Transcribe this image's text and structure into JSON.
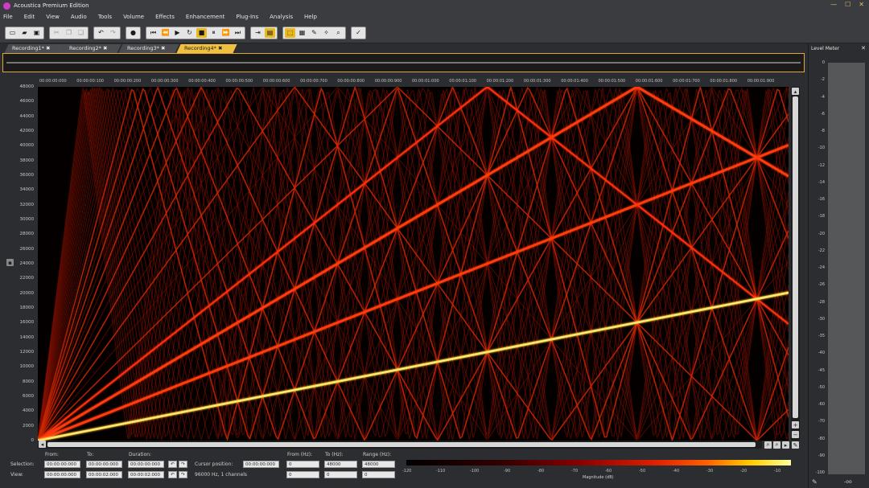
{
  "window": {
    "title": "Acoustica Premium Edition"
  },
  "menu": [
    "File",
    "Edit",
    "View",
    "Audio",
    "Tools",
    "Volume",
    "Effects",
    "Enhancement",
    "Plug-Ins",
    "Analysis",
    "Help"
  ],
  "tabs": [
    {
      "label": "Recording1*",
      "active": false
    },
    {
      "label": "Recording2*",
      "active": false
    },
    {
      "label": "Recording3*",
      "active": false
    },
    {
      "label": "Recording4*",
      "active": true
    }
  ],
  "frequency_axis": [
    "48000",
    "46000",
    "44000",
    "42000",
    "40000",
    "38000",
    "36000",
    "34000",
    "32000",
    "30000",
    "28000",
    "26000",
    "24000",
    "22000",
    "20000",
    "18000",
    "16000",
    "14000",
    "12000",
    "10000",
    "8000",
    "6000",
    "4000",
    "2000",
    "0"
  ],
  "time_axis": [
    "00:00:00:000",
    "00:00:00:100",
    "00:00:00:200",
    "00:00:00:300",
    "00:00:00:400",
    "00:00:00:500",
    "00:00:00:600",
    "00:00:00:700",
    "00:00:00:800",
    "00:00:00:900",
    "00:00:01:000",
    "00:00:01:100",
    "00:00:01:200",
    "00:00:01:300",
    "00:00:01:400",
    "00:00:01:500",
    "00:00:01:600",
    "00:00:01:700",
    "00:00:01:800",
    "00:00:01:900"
  ],
  "status": {
    "from_label": "From:",
    "to_label": "To:",
    "duration_label": "Duration:",
    "selection_label": "Selection:",
    "view_label": "View:",
    "selection_from": "00:00:00:000",
    "selection_to": "00:00:00:000",
    "selection_duration": "00:00:00:000",
    "view_from": "00:00:00:000",
    "view_to": "00:00:02:000",
    "view_duration": "00:00:02:000",
    "cursor_label": "Cursor position:",
    "cursor_value": "00:00:00:000",
    "format": "96000 Hz, 1 channels",
    "from_hz_label": "From (Hz):",
    "to_hz_label": "To (Hz):",
    "range_hz_label": "Range (Hz):",
    "sel_from_hz": "0",
    "sel_to_hz": "48000",
    "sel_range_hz": "48000",
    "view_from_hz": "0",
    "view_to_hz": "0",
    "view_range_hz": "0"
  },
  "colorbar": {
    "ticks": [
      "-120",
      "-110",
      "-100",
      "-90",
      "-80",
      "-70",
      "-60",
      "-50",
      "-40",
      "-30",
      "-20",
      "-10"
    ],
    "label": "Magnitude (dB)"
  },
  "level_meter": {
    "title": "Level Meter",
    "scale": [
      "0",
      "-2",
      "-4",
      "-6",
      "-8",
      "-10",
      "-12",
      "-14",
      "-16",
      "-18",
      "-20",
      "-22",
      "-24",
      "-26",
      "-28",
      "-30",
      "-35",
      "-40",
      "-45",
      "-50",
      "-60",
      "-70",
      "-80",
      "-90",
      "-100"
    ],
    "readout": "-oo"
  }
}
